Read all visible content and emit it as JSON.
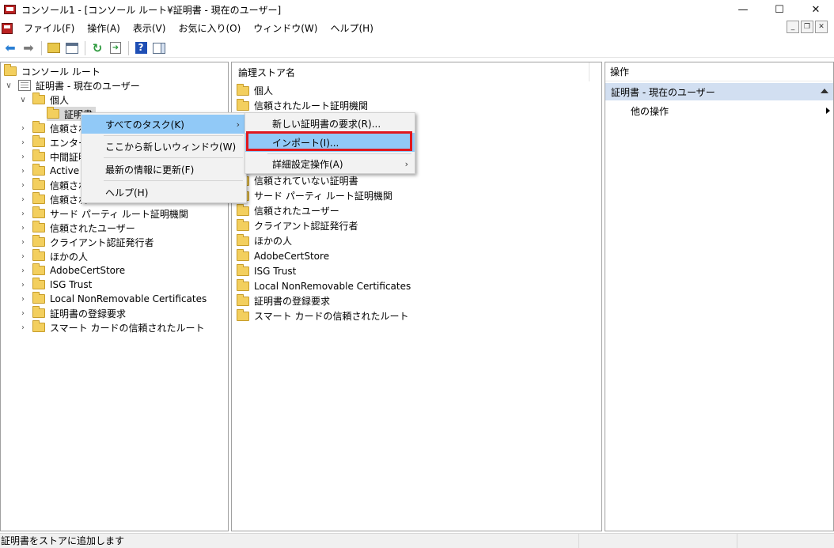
{
  "window": {
    "title": "コンソール1 - [コンソール ルート¥証明書 - 現在のユーザー]",
    "controls": {
      "minimize": "—",
      "maximize": "☐",
      "close": "✕"
    }
  },
  "menubar": {
    "items": [
      "ファイル(F)",
      "操作(A)",
      "表示(V)",
      "お気に入り(O)",
      "ウィンドウ(W)",
      "ヘルプ(H)"
    ],
    "mdi": {
      "minimize": "_",
      "restore": "❐",
      "close": "✕"
    }
  },
  "toolbar": {
    "icons": [
      "back-icon",
      "forward-icon",
      "up-folder-icon",
      "show-hide-tree-icon",
      "refresh-icon",
      "export-list-icon",
      "help-icon",
      "show-hide-action-pane-icon"
    ]
  },
  "tree": {
    "root": "コンソール ルート",
    "certs": "証明書 - 現在のユーザー",
    "personal": "個人",
    "personal_certs": "証明書",
    "items": [
      "信頼され",
      "エンタープ",
      "中間証明",
      "Active D",
      "信頼され",
      "信頼され",
      "サード パーティ ルート証明機関",
      "信頼されたユーザー",
      "クライアント認証発行者",
      "ほかの人",
      "AdobeCertStore",
      "ISG Trust",
      "Local NonRemovable Certificates",
      "証明書の登録要求",
      "スマート カードの信頼されたルート"
    ]
  },
  "list": {
    "header": "論理ストア名",
    "items_top": [
      "個人",
      "信頼されたルート証明機関"
    ],
    "items_bottom": [
      "信頼されていない証明書",
      "サード パーティ ルート証明機関",
      "信頼されたユーザー",
      "クライアント認証発行者",
      "ほかの人",
      "AdobeCertStore",
      "ISG Trust",
      "Local NonRemovable Certificates",
      "証明書の登録要求",
      "スマート カードの信頼されたルート"
    ]
  },
  "actions": {
    "header": "操作",
    "section": "証明書 - 現在のユーザー",
    "item": "他の操作"
  },
  "context_menu": {
    "all_tasks": "すべてのタスク(K)",
    "new_window": "ここから新しいウィンドウ(W)",
    "refresh": "最新の情報に更新(F)",
    "help": "ヘルプ(H)",
    "arrow": "›"
  },
  "submenu": {
    "request_new": "新しい証明書の要求(R)...",
    "import": "インポート(I)...",
    "advanced": "詳細設定操作(A)",
    "arrow": "›"
  },
  "status": {
    "text": "証明書をストアに追加します"
  },
  "colors": {
    "highlight": "#91c9f7",
    "annotation_box": "#e0181e",
    "action_section": "#d2dff1"
  }
}
